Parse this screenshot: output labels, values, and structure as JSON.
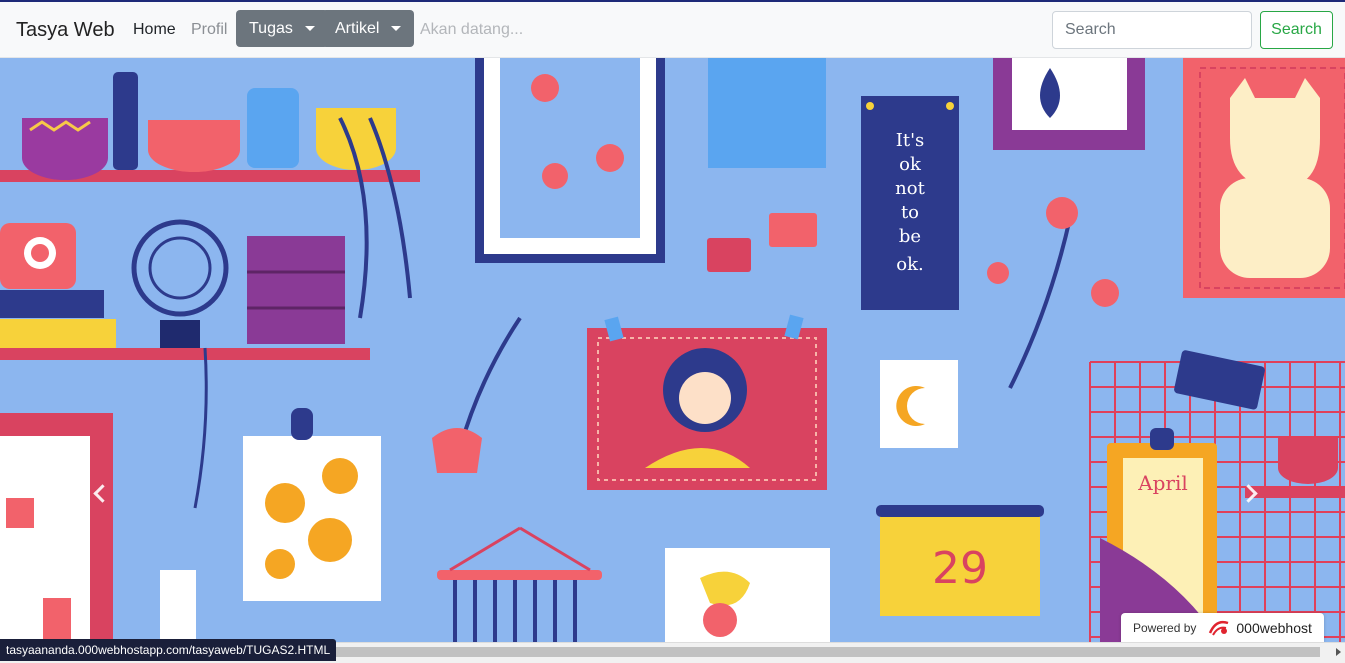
{
  "navbar": {
    "brand": "Tasya Web",
    "links": {
      "home": "Home",
      "profil": "Profil",
      "tugas": "Tugas",
      "artikel": "Artikel",
      "soon": "Akan datang..."
    },
    "search": {
      "placeholder": "Search",
      "button": "Search"
    }
  },
  "carousel": {
    "artwork_text": {
      "poster": "It's ok not to be ok.",
      "calendar_day": "29",
      "clipboard": "April"
    },
    "icons": {
      "prev": "chevron-left-icon",
      "next": "chevron-right-icon"
    }
  },
  "badge": {
    "powered_label": "Powered by",
    "host_name": "000webhost"
  },
  "status_bar": {
    "url": "tasyaananda.000webhostapp.com/tasyaweb/TUGAS2.HTML"
  },
  "colors": {
    "accent_green": "#28a745",
    "dropdown_gray": "#6c757d",
    "wall_blue": "#8cb6ef"
  }
}
